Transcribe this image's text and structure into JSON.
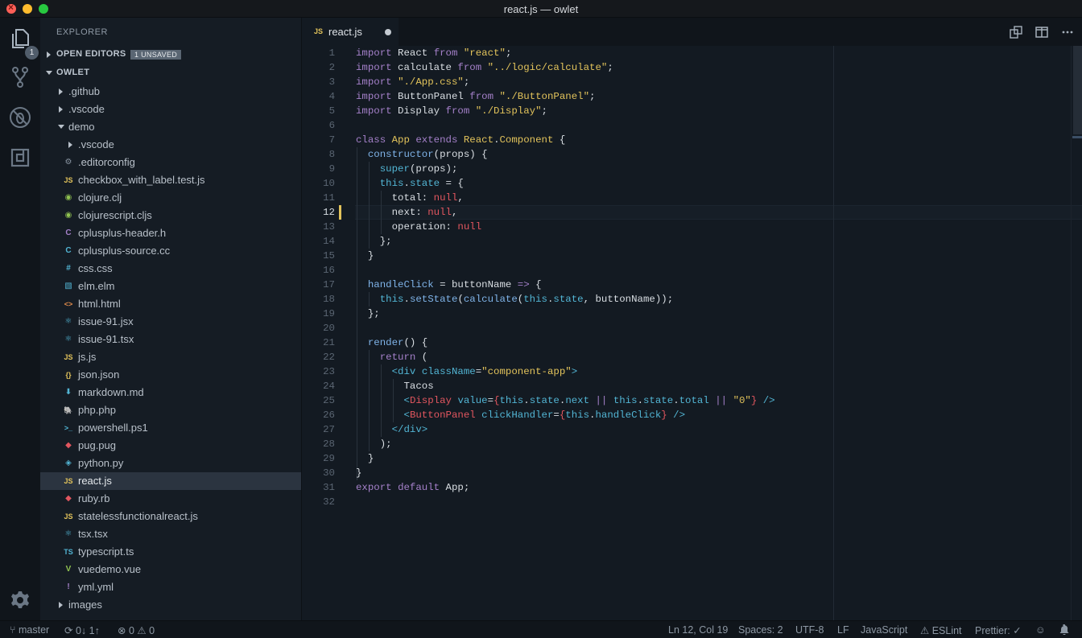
{
  "window": {
    "title": "react.js — owlet"
  },
  "activity": {
    "explorer_badge": "1"
  },
  "sidebar": {
    "title": "EXPLORER",
    "open_editors_label": "OPEN EDITORS",
    "unsaved_badge": "1 UNSAVED",
    "project_label": "OWLET",
    "items": [
      {
        "name": ".github",
        "kind": "folder",
        "depth": 1,
        "open": false
      },
      {
        "name": ".vscode",
        "kind": "folder",
        "depth": 1,
        "open": false
      },
      {
        "name": "demo",
        "kind": "folder",
        "depth": 1,
        "open": true
      },
      {
        "name": ".vscode",
        "kind": "folder",
        "depth": 2,
        "open": false
      },
      {
        "name": ".editorconfig",
        "kind": "file",
        "icon": "⚙",
        "color": "#8a96a3"
      },
      {
        "name": "checkbox_with_label.test.js",
        "kind": "file",
        "icon": "JS",
        "color": "#e2c35b"
      },
      {
        "name": "clojure.clj",
        "kind": "file",
        "icon": "◉",
        "color": "#8fc150"
      },
      {
        "name": "clojurescript.cljs",
        "kind": "file",
        "icon": "◉",
        "color": "#8fc150"
      },
      {
        "name": "cplusplus-header.h",
        "kind": "file",
        "icon": "C",
        "color": "#a480c9"
      },
      {
        "name": "cplusplus-source.cc",
        "kind": "file",
        "icon": "C",
        "color": "#52b5d4"
      },
      {
        "name": "css.css",
        "kind": "file",
        "icon": "#",
        "color": "#52b5d4"
      },
      {
        "name": "elm.elm",
        "kind": "file",
        "icon": "▧",
        "color": "#52b5d4"
      },
      {
        "name": "html.html",
        "kind": "file",
        "icon": "<>",
        "color": "#e08b4b"
      },
      {
        "name": "issue-91.jsx",
        "kind": "file",
        "icon": "⚛",
        "color": "#52b5d4"
      },
      {
        "name": "issue-91.tsx",
        "kind": "file",
        "icon": "⚛",
        "color": "#52b5d4"
      },
      {
        "name": "js.js",
        "kind": "file",
        "icon": "JS",
        "color": "#e2c35b"
      },
      {
        "name": "json.json",
        "kind": "file",
        "icon": "{}",
        "color": "#e2c35b"
      },
      {
        "name": "markdown.md",
        "kind": "file",
        "icon": "⬇",
        "color": "#52b5d4"
      },
      {
        "name": "php.php",
        "kind": "file",
        "icon": "🐘",
        "color": "#a480c9"
      },
      {
        "name": "powershell.ps1",
        "kind": "file",
        "icon": ">_",
        "color": "#52b5d4"
      },
      {
        "name": "pug.pug",
        "kind": "file",
        "icon": "◆",
        "color": "#e2565f"
      },
      {
        "name": "python.py",
        "kind": "file",
        "icon": "◈",
        "color": "#52b5d4"
      },
      {
        "name": "react.js",
        "kind": "file",
        "icon": "JS",
        "color": "#e2c35b",
        "selected": true
      },
      {
        "name": "ruby.rb",
        "kind": "file",
        "icon": "◆",
        "color": "#e2565f"
      },
      {
        "name": "statelessfunctionalreact.js",
        "kind": "file",
        "icon": "JS",
        "color": "#e2c35b"
      },
      {
        "name": "tsx.tsx",
        "kind": "file",
        "icon": "⚛",
        "color": "#52b5d4"
      },
      {
        "name": "typescript.ts",
        "kind": "file",
        "icon": "TS",
        "color": "#52b5d4"
      },
      {
        "name": "vuedemo.vue",
        "kind": "file",
        "icon": "V",
        "color": "#8fc150"
      },
      {
        "name": "yml.yml",
        "kind": "file",
        "icon": "!",
        "color": "#a480c9"
      },
      {
        "name": "images",
        "kind": "folder",
        "depth": 1,
        "open": false
      }
    ]
  },
  "tab": {
    "lang": "JS",
    "name": "react.js"
  },
  "editor": {
    "active_line": 12,
    "lines": [
      [
        [
          "k",
          "import"
        ],
        [
          "p",
          " React "
        ],
        [
          "k",
          "from"
        ],
        [
          "p",
          " "
        ],
        [
          "s",
          "\"react\""
        ],
        [
          "p",
          ";"
        ]
      ],
      [
        [
          "k",
          "import"
        ],
        [
          "p",
          " calculate "
        ],
        [
          "k",
          "from"
        ],
        [
          "p",
          " "
        ],
        [
          "s",
          "\"../logic/calculate\""
        ],
        [
          "p",
          ";"
        ]
      ],
      [
        [
          "k",
          "import"
        ],
        [
          "p",
          " "
        ],
        [
          "s",
          "\"./App.css\""
        ],
        [
          "p",
          ";"
        ]
      ],
      [
        [
          "k",
          "import"
        ],
        [
          "p",
          " ButtonPanel "
        ],
        [
          "k",
          "from"
        ],
        [
          "p",
          " "
        ],
        [
          "s",
          "\"./ButtonPanel\""
        ],
        [
          "p",
          ";"
        ]
      ],
      [
        [
          "k",
          "import"
        ],
        [
          "p",
          " Display "
        ],
        [
          "k",
          "from"
        ],
        [
          "p",
          " "
        ],
        [
          "s",
          "\"./Display\""
        ],
        [
          "p",
          ";"
        ]
      ],
      [],
      [
        [
          "k",
          "class"
        ],
        [
          "p",
          " "
        ],
        [
          "c",
          "App"
        ],
        [
          "p",
          " "
        ],
        [
          "k",
          "extends"
        ],
        [
          "p",
          " "
        ],
        [
          "c",
          "React"
        ],
        [
          "p",
          "."
        ],
        [
          "c",
          "Component"
        ],
        [
          "p",
          " {"
        ]
      ],
      [
        [
          "p",
          "  "
        ],
        [
          "f",
          "constructor"
        ],
        [
          "p",
          "(props) {"
        ]
      ],
      [
        [
          "p",
          "    "
        ],
        [
          "t",
          "super"
        ],
        [
          "p",
          "(props);"
        ]
      ],
      [
        [
          "p",
          "    "
        ],
        [
          "t",
          "this"
        ],
        [
          "p",
          "."
        ],
        [
          "t",
          "state"
        ],
        [
          "p",
          " = {"
        ]
      ],
      [
        [
          "p",
          "      total: "
        ],
        [
          "n",
          "null"
        ],
        [
          "p",
          ","
        ]
      ],
      [
        [
          "p",
          "      next: "
        ],
        [
          "n",
          "null"
        ],
        [
          "p",
          ","
        ]
      ],
      [
        [
          "p",
          "      operation: "
        ],
        [
          "n",
          "null"
        ]
      ],
      [
        [
          "p",
          "    };"
        ]
      ],
      [
        [
          "p",
          "  }"
        ]
      ],
      [],
      [
        [
          "p",
          "  "
        ],
        [
          "f",
          "handleClick"
        ],
        [
          "p",
          " = buttonName "
        ],
        [
          "o",
          "=>"
        ],
        [
          "p",
          " {"
        ]
      ],
      [
        [
          "p",
          "    "
        ],
        [
          "t",
          "this"
        ],
        [
          "p",
          "."
        ],
        [
          "f",
          "setState"
        ],
        [
          "p",
          "("
        ],
        [
          "f",
          "calculate"
        ],
        [
          "p",
          "("
        ],
        [
          "t",
          "this"
        ],
        [
          "p",
          "."
        ],
        [
          "t",
          "state"
        ],
        [
          "p",
          ", buttonName));"
        ]
      ],
      [
        [
          "p",
          "  };"
        ]
      ],
      [],
      [
        [
          "p",
          "  "
        ],
        [
          "f",
          "render"
        ],
        [
          "p",
          "() {"
        ]
      ],
      [
        [
          "p",
          "    "
        ],
        [
          "k",
          "return"
        ],
        [
          "p",
          " ("
        ]
      ],
      [
        [
          "p",
          "      "
        ],
        [
          "g",
          "<div"
        ],
        [
          "p",
          " "
        ],
        [
          "t",
          "className"
        ],
        [
          "p",
          "="
        ],
        [
          "s",
          "\"component-app\""
        ],
        [
          "g",
          ">"
        ]
      ],
      [
        [
          "p",
          "        Tacos"
        ]
      ],
      [
        [
          "p",
          "        "
        ],
        [
          "g",
          "<"
        ],
        [
          "n",
          "Display"
        ],
        [
          "p",
          " "
        ],
        [
          "t",
          "value"
        ],
        [
          "p",
          "="
        ],
        [
          "br",
          "{"
        ],
        [
          "t",
          "this"
        ],
        [
          "p",
          "."
        ],
        [
          "t",
          "state"
        ],
        [
          "p",
          "."
        ],
        [
          "t",
          "next"
        ],
        [
          "p",
          " "
        ],
        [
          "o",
          "||"
        ],
        [
          "p",
          " "
        ],
        [
          "t",
          "this"
        ],
        [
          "p",
          "."
        ],
        [
          "t",
          "state"
        ],
        [
          "p",
          "."
        ],
        [
          "t",
          "total"
        ],
        [
          "p",
          " "
        ],
        [
          "o",
          "||"
        ],
        [
          "p",
          " "
        ],
        [
          "s",
          "\"0\""
        ],
        [
          "br",
          "}"
        ],
        [
          "p",
          " "
        ],
        [
          "g",
          "/>"
        ]
      ],
      [
        [
          "p",
          "        "
        ],
        [
          "g",
          "<"
        ],
        [
          "n",
          "ButtonPanel"
        ],
        [
          "p",
          " "
        ],
        [
          "t",
          "clickHandler"
        ],
        [
          "p",
          "="
        ],
        [
          "br",
          "{"
        ],
        [
          "t",
          "this"
        ],
        [
          "p",
          "."
        ],
        [
          "t",
          "handleClick"
        ],
        [
          "br",
          "}"
        ],
        [
          "p",
          " "
        ],
        [
          "g",
          "/>"
        ]
      ],
      [
        [
          "p",
          "      "
        ],
        [
          "g",
          "</div>"
        ]
      ],
      [
        [
          "p",
          "    );"
        ]
      ],
      [
        [
          "p",
          "  }"
        ]
      ],
      [
        [
          "p",
          "}"
        ]
      ],
      [
        [
          "k",
          "export"
        ],
        [
          "p",
          " "
        ],
        [
          "k",
          "default"
        ],
        [
          "p",
          " App;"
        ]
      ],
      []
    ]
  },
  "status": {
    "branch": "master",
    "sync": "0↓ 1↑",
    "problems": "0",
    "warnings": "0",
    "position": "Ln 12, Col 19",
    "spaces": "Spaces: 2",
    "encoding": "UTF-8",
    "eol": "LF",
    "language": "JavaScript",
    "eslint": "ESLint",
    "prettier": "Prettier: ✓"
  }
}
